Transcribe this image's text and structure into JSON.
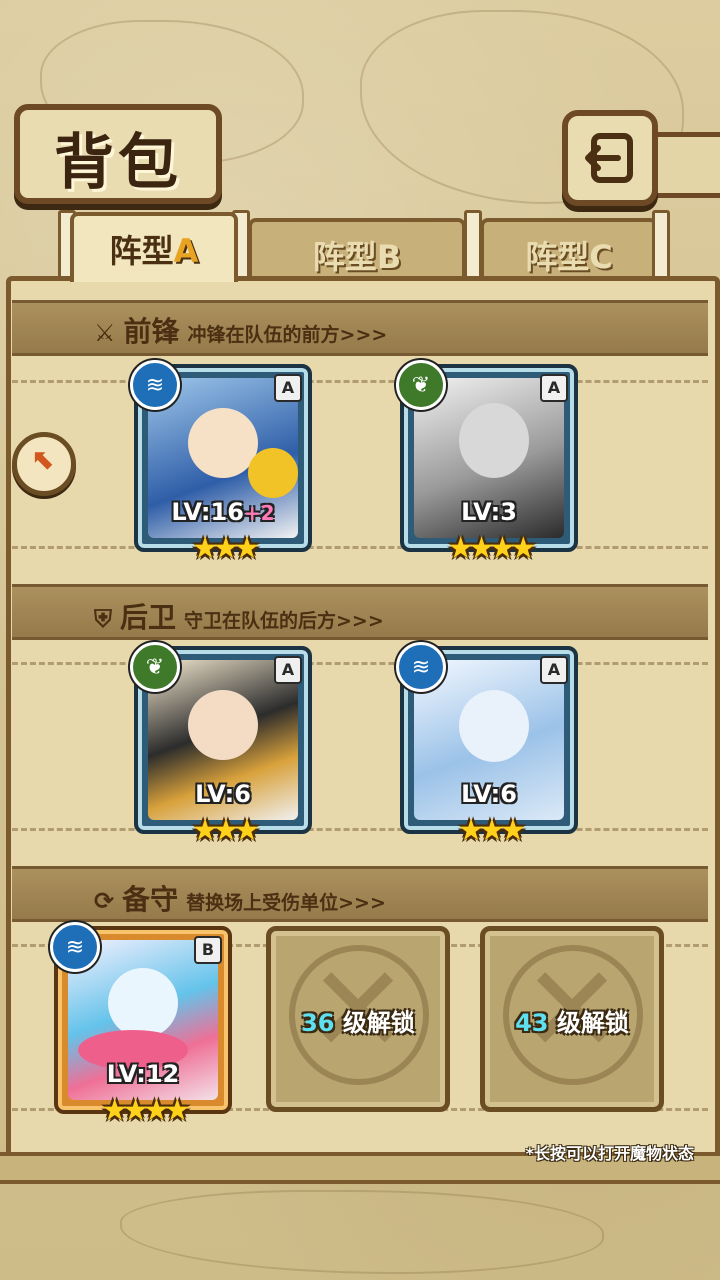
{
  "header": {
    "title": "背包",
    "back_label": "返回"
  },
  "tabs": [
    {
      "label_prefix": "阵型",
      "label_suffix": "A",
      "active": true
    },
    {
      "label_prefix": "阵型",
      "label_suffix": "B",
      "active": false
    },
    {
      "label_prefix": "阵型",
      "label_suffix": "C",
      "active": false
    }
  ],
  "sections": {
    "front": {
      "icon": "sword-icon",
      "name": "前锋",
      "desc": "冲锋在队伍的前方>>>"
    },
    "back": {
      "icon": "shield-icon",
      "name": "后卫",
      "desc": "守卫在队伍的后方>>>"
    },
    "reserve": {
      "icon": "swap-icon",
      "name": "备守",
      "desc": "替换场上受伤单位>>>"
    }
  },
  "units": {
    "front_1": {
      "element": "water",
      "grade": "A",
      "level": "LV:16",
      "bonus": "+2",
      "stars": "★★★"
    },
    "front_2": {
      "element": "leaf",
      "grade": "A",
      "level": "LV:3",
      "stars": "★★★★"
    },
    "back_1": {
      "element": "leaf",
      "grade": "A",
      "level": "LV:6",
      "stars": "★★★"
    },
    "back_2": {
      "element": "water",
      "grade": "A",
      "level": "LV:6",
      "stars": "★★★"
    },
    "reserve_1": {
      "element": "water",
      "grade": "B",
      "level": "LV:12",
      "stars": "★★★★"
    }
  },
  "locked_slots": [
    {
      "level": "36",
      "text": "级解锁"
    },
    {
      "level": "43",
      "text": "级解锁"
    }
  ],
  "hint": "*长按可以打开魔物状态",
  "side_button_icon": "arrow-up-left-icon"
}
